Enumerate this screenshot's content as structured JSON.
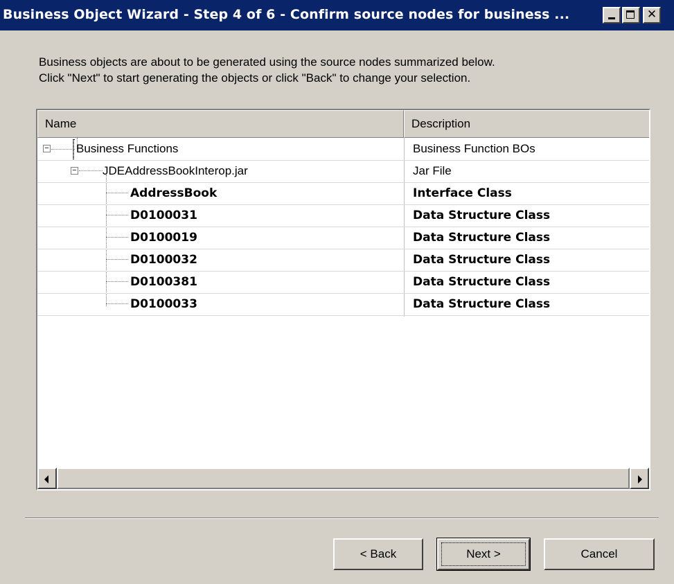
{
  "window": {
    "title": "Business Object Wizard - Step 4 of 6 - Confirm source nodes for business ..."
  },
  "intro": {
    "line1": "Business objects are about to be generated using the source nodes summarized below.",
    "line2": "Click \"Next\" to start generating the objects or click \"Back\" to change your selection."
  },
  "tree": {
    "columns": [
      "Name",
      "Description"
    ],
    "rows": [
      {
        "name": "Business Functions",
        "description": "Business Function BOs"
      },
      {
        "name": "JDEAddressBookInterop.jar",
        "description": "Jar File"
      },
      {
        "name": "AddressBook",
        "description": "Interface Class"
      },
      {
        "name": "D0100031",
        "description": "Data Structure Class"
      },
      {
        "name": "D0100019",
        "description": "Data Structure Class"
      },
      {
        "name": "D0100032",
        "description": "Data Structure Class"
      },
      {
        "name": "D0100381",
        "description": "Data Structure Class"
      },
      {
        "name": "D0100033",
        "description": "Data Structure Class"
      }
    ]
  },
  "buttons": {
    "back": "< Back",
    "next": "Next >",
    "cancel": "Cancel"
  },
  "icons": {
    "minimize": "minimize-icon",
    "maximize": "maximize-icon",
    "close": "close-icon",
    "expander": "collapse-minus-icon"
  },
  "colors": {
    "titlebar": "#0a246a",
    "dialog": "#d4d0c8"
  }
}
